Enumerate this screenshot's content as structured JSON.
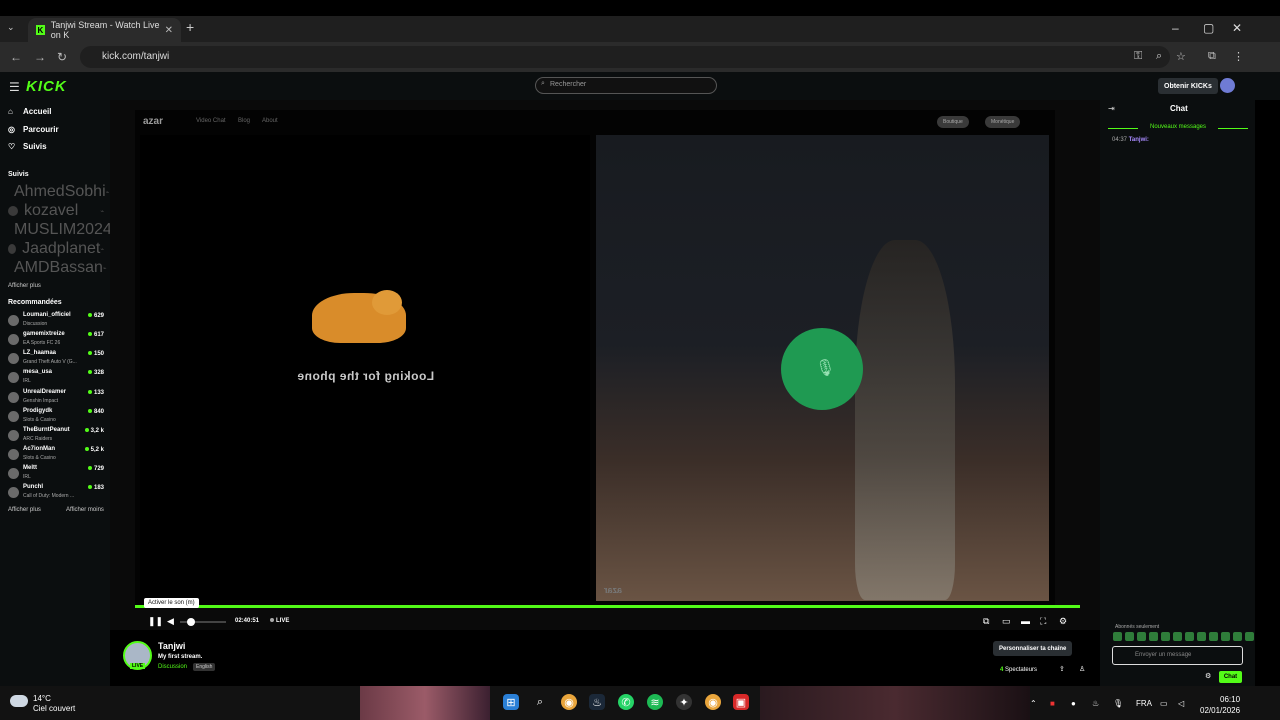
{
  "browser": {
    "tab_title": "Tanjwi Stream - Watch Live on K",
    "url": "kick.com/tanjwi",
    "new_tab": "+",
    "close": "✕"
  },
  "kick": {
    "logo": "KICK",
    "search_placeholder": "Rechercher",
    "kicks_button": "Obtenir KICKs"
  },
  "sidebar": {
    "nav": [
      {
        "label": "Accueil"
      },
      {
        "label": "Parcourir"
      },
      {
        "label": "Suivis"
      }
    ],
    "followed_header": "Suivis",
    "followed": [
      "AhmedSobhi",
      "kozavel",
      "MUSLIM2024",
      "Jaadplanet",
      "AMDBassan"
    ],
    "show_more": "Afficher plus",
    "recommended_header": "Recommandées",
    "recommended": [
      {
        "name": "Loumani_officiel",
        "category": "Discussion",
        "viewers": "629"
      },
      {
        "name": "gamemixtreize",
        "category": "EA Sports FC 26",
        "viewers": "617"
      },
      {
        "name": "LZ_haamaa",
        "category": "Grand Theft Auto V (G...",
        "viewers": "150"
      },
      {
        "name": "mesa_usa",
        "category": "IRL",
        "viewers": "328"
      },
      {
        "name": "UnrealDreamer",
        "category": "Genshin Impact",
        "viewers": "133"
      },
      {
        "name": "Prodigydk",
        "category": "Slots & Casino",
        "viewers": "840"
      },
      {
        "name": "TheBurntPeanut",
        "category": "ARC Raiders",
        "viewers": "3,2 k"
      },
      {
        "name": "Ac7ionMan",
        "category": "Slots & Casino",
        "viewers": "5,2 k"
      },
      {
        "name": "Meltt",
        "category": "IRL",
        "viewers": "729"
      },
      {
        "name": "PunchI",
        "category": "Call of Duty: Modern ...",
        "viewers": "183"
      }
    ],
    "show_more2": "Afficher plus",
    "show_less": "Afficher moins"
  },
  "video": {
    "azar_logo": "azar",
    "azar_tabs": [
      "Video Chat",
      "Blog",
      "About"
    ],
    "azar_pills": [
      "Boutique",
      "Monétique"
    ],
    "looking_text": "Looking for the phone",
    "azar_watermark": "azar",
    "tooltip": "Activer le son (m)",
    "time": "02:40:51",
    "live_label": "LIVE",
    "icons": {
      "play": "pause-icon",
      "mic": "mic-icon"
    }
  },
  "channel": {
    "name": "Tanjwi",
    "live_badge": "LIVE",
    "stream_title": "My first stream.",
    "category": "Discussion",
    "language": "English",
    "customize_button": "Personnaliser ta chaîne",
    "viewers_count": "4",
    "viewers_label": "Spectateurs"
  },
  "chat": {
    "header": "Chat",
    "new_messages": "Nouveaux messages",
    "message_time": "04:37",
    "message_user": "Tanjwi:",
    "subs_only": "Abonnés seulement",
    "input_placeholder": "Envoyer un message",
    "send_button": "Chat"
  },
  "taskbar": {
    "temperature": "14°C",
    "weather_desc": "Ciel couvert",
    "lang": "FRA",
    "time": "06:10",
    "date": "02/01/2026"
  },
  "colors": {
    "kick_green": "#53fc18",
    "azar_green": "#1f9a52"
  }
}
